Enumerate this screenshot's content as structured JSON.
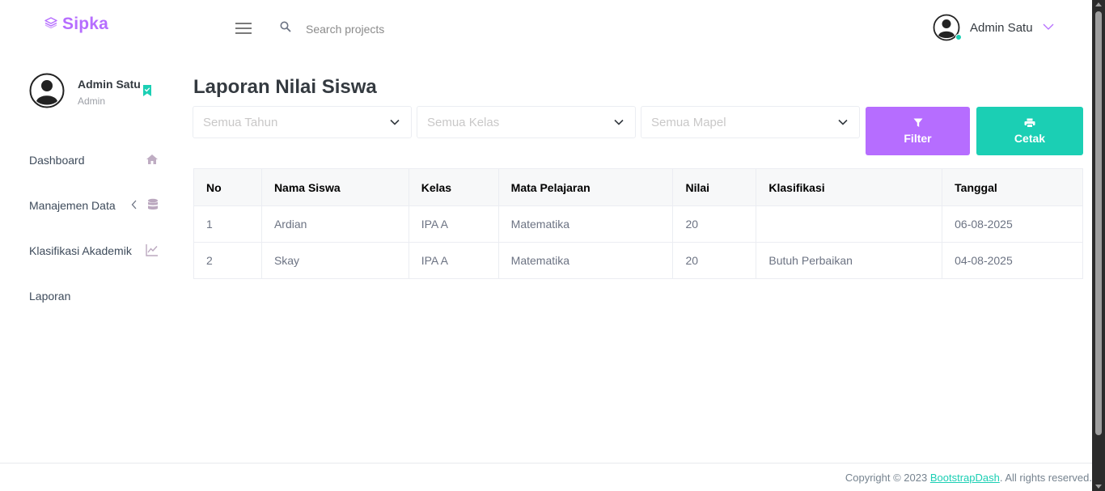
{
  "brand": {
    "name": "Sipka",
    "icon": "layers-icon",
    "color": "#b66dff"
  },
  "navbar": {
    "menu_icon": "hamburger-icon",
    "search": {
      "icon": "search-icon",
      "placeholder": "Search projects"
    },
    "profile": {
      "name": "Admin Satu",
      "avatar_icon": "user-avatar-icon",
      "status_color": "#1bcfb4",
      "dropdown_icon": "chevron-down-icon"
    }
  },
  "sidebar": {
    "profile": {
      "name": "Admin Satu",
      "role": "Admin",
      "badge_icon": "bookmark-check-icon"
    },
    "items": [
      {
        "label": "Dashboard",
        "icon": "home-icon"
      },
      {
        "label": "Manajemen Data",
        "icon": "database-icon",
        "arrow_icon": "chevron-left-icon"
      },
      {
        "label": "Klasifikasi Akademik",
        "icon": "chart-line-icon"
      },
      {
        "label": "Laporan"
      }
    ]
  },
  "main": {
    "title": "Laporan Nilai Siswa",
    "filters": {
      "year": "Semua Tahun",
      "class": "Semua Kelas",
      "subject": "Semua Mapel"
    },
    "buttons": {
      "filter": {
        "label": "Filter",
        "icon": "filter-icon",
        "color": "#b66dff"
      },
      "print": {
        "label": "Cetak",
        "icon": "printer-icon",
        "color": "#1bcfb4"
      }
    },
    "table": {
      "headers": [
        "No",
        "Nama Siswa",
        "Kelas",
        "Mata Pelajaran",
        "Nilai",
        "Klasifikasi",
        "Tanggal"
      ],
      "rows": [
        [
          "1",
          "Ardian",
          "IPA A",
          "Matematika",
          "20",
          "",
          "06-08-2025"
        ],
        [
          "2",
          "Skay",
          "IPA A",
          "Matematika",
          "20",
          "Butuh Perbaikan",
          "04-08-2025"
        ]
      ]
    }
  },
  "footer": {
    "prefix": "Copyright © 2023 ",
    "link": "BootstrapDash",
    "suffix": ". All rights reserved."
  }
}
